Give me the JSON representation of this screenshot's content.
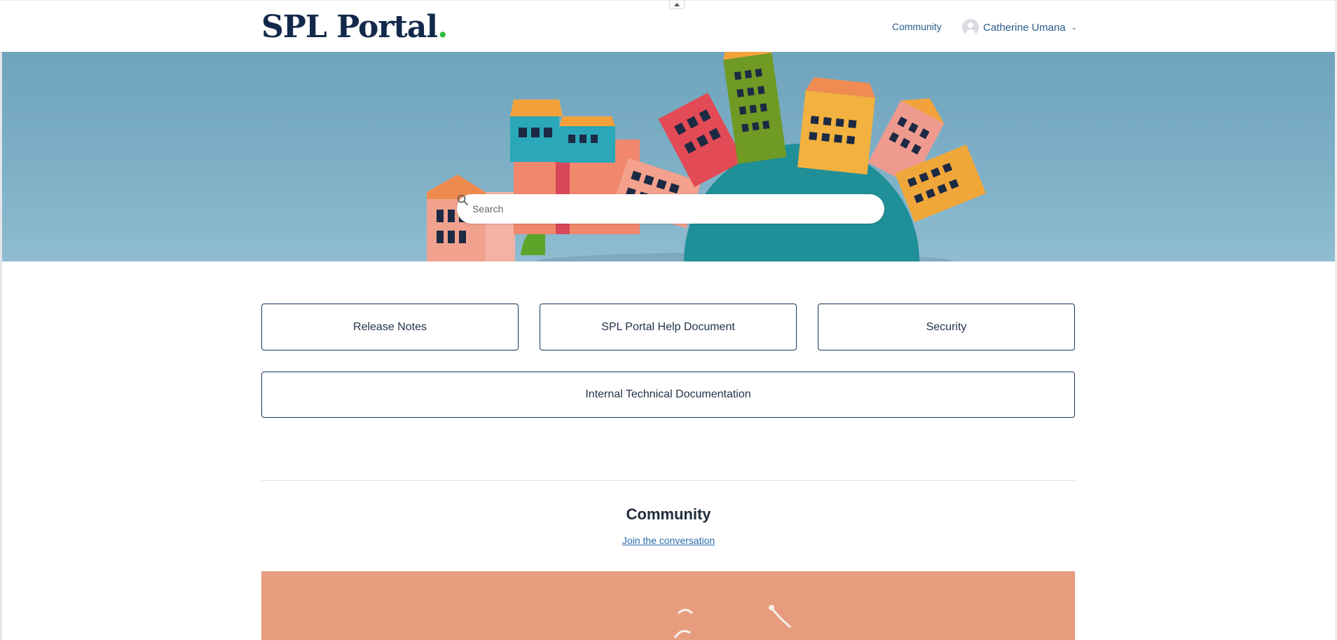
{
  "header": {
    "logo_text": "SPL Portal",
    "logo_dot": ".",
    "nav_community": "Community",
    "user_name": "Catherine Umana",
    "user_chevron": "⌄"
  },
  "search": {
    "placeholder": "Search"
  },
  "tiles": [
    {
      "label": "Release Notes"
    },
    {
      "label": "SPL Portal Help Document"
    },
    {
      "label": "Security"
    },
    {
      "label": "Internal Technical Documentation"
    }
  ],
  "community": {
    "title": "Community",
    "link": "Join the conversation"
  },
  "colors": {
    "brand_navy": "#13294b",
    "logo_dot": "#2fbd3c",
    "link_blue": "#2a5b8e",
    "banner": "#e89c7e"
  }
}
